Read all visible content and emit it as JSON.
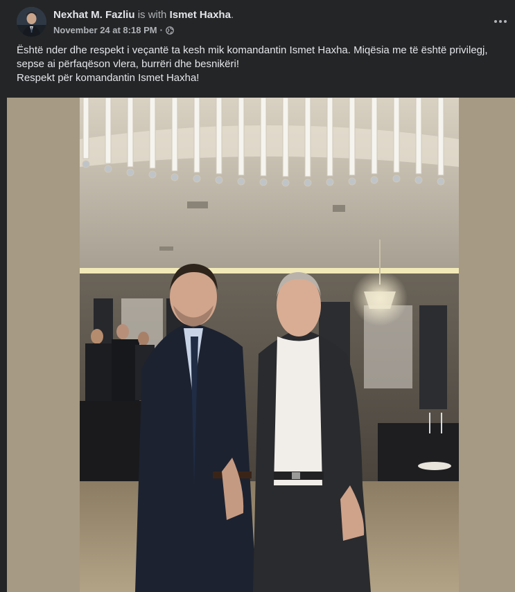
{
  "post": {
    "author": "Nexhat M. Fazliu",
    "with_text": "is with",
    "tagged": "Ismet Haxha",
    "tagged_suffix": ".",
    "timestamp": "November 24 at 8:18 PM",
    "separator": "·",
    "privacy_icon": "globe-icon",
    "more_icon": "more-options-icon",
    "caption_lines": [
      "Është nder dhe respekt i veçantë ta kesh mik komandantin Ismet Haxha. Miqësia me të është privilegj, sepse ai përfaqëson vlera, burrëri dhe besnikëri!",
      "Respekt për komandantin Ismet Haxha!"
    ]
  },
  "colors": {
    "card_background": "#242526",
    "primary_text": "#e4e6eb",
    "secondary_text": "#b0b3b8",
    "photo_backdrop": "#a69a84"
  }
}
